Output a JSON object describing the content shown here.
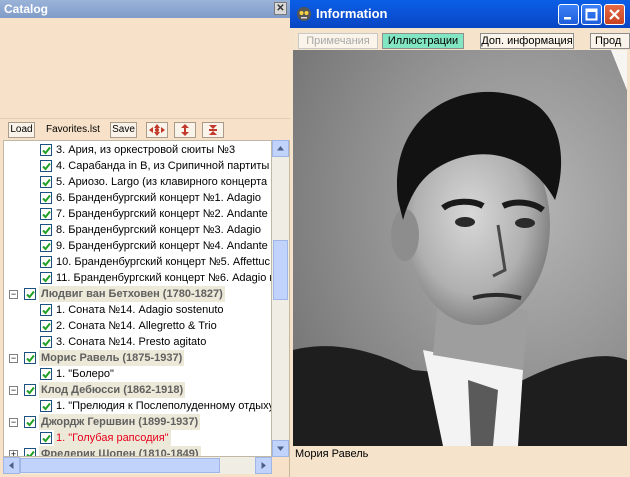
{
  "catalog": {
    "title": "Catalog",
    "toolbar": {
      "load_label": "Load",
      "favorites_label": "Favorites.lst",
      "save_label": "Save"
    },
    "tree": [
      {
        "kind": "item",
        "checked": true,
        "text": "3. Ария, из оркестровой сюиты №3"
      },
      {
        "kind": "item",
        "checked": true,
        "text": "4. Сарабанда in B, из Срипичной партиты №"
      },
      {
        "kind": "item",
        "checked": true,
        "text": "5. Ариозо. Largo (из клавирного концерта"
      },
      {
        "kind": "item",
        "checked": true,
        "text": "6. Бранденбургский концерт №1. Adagio"
      },
      {
        "kind": "item",
        "checked": true,
        "text": "7. Бранденбургский концерт №2. Andante"
      },
      {
        "kind": "item",
        "checked": true,
        "text": "8. Бранденбургский концерт №3. Adagio"
      },
      {
        "kind": "item",
        "checked": true,
        "text": "9. Бранденбургский концерт №4. Andante"
      },
      {
        "kind": "item",
        "checked": true,
        "text": "10. Бранденбургский концерт №5. Affettuc"
      },
      {
        "kind": "item",
        "checked": true,
        "text": "11. Бранденбургский концерт №6. Adagio r"
      },
      {
        "kind": "composer",
        "expanded": true,
        "checked": true,
        "text": "Людвиг ван Бетховен (1780-1827)"
      },
      {
        "kind": "item",
        "checked": true,
        "text": "1. Соната №14. Adagio sostenuto"
      },
      {
        "kind": "item",
        "checked": true,
        "text": "2. Соната №14. Allegretto & Trio"
      },
      {
        "kind": "item",
        "checked": true,
        "text": "3. Соната №14. Presto agitato"
      },
      {
        "kind": "composer",
        "expanded": true,
        "checked": true,
        "text": "Морис Равель (1875-1937)"
      },
      {
        "kind": "item",
        "checked": true,
        "text": "1. \"Болеро\""
      },
      {
        "kind": "composer",
        "expanded": true,
        "checked": true,
        "text": "Клод Дебюсси (1862-1918)"
      },
      {
        "kind": "item",
        "checked": true,
        "text": "1. \"Прелюдия к Послеполуденному отдыху"
      },
      {
        "kind": "composer",
        "expanded": true,
        "checked": true,
        "text": "Джордж Гершвин (1899-1937)"
      },
      {
        "kind": "selected",
        "checked": true,
        "text": "1. \"Голубая рапсодия\""
      },
      {
        "kind": "composer",
        "expanded": false,
        "checked": true,
        "text": "Фредерик Шопен (1810-1849)"
      }
    ]
  },
  "info": {
    "title": "Information",
    "tabs": [
      {
        "label": "Примечания",
        "state": "disabled"
      },
      {
        "label": "Иллюстрации",
        "state": "active"
      },
      {
        "label": "Доп. информация",
        "state": "normal"
      },
      {
        "label": "Прод",
        "state": "normal"
      }
    ],
    "caption": "Мория Равель"
  },
  "colors": {
    "panel_bg": "#f7e2c9",
    "titlebar_blue": "#0a5fe6",
    "active_tab": "#83e6c3",
    "selected_text": "#e8001c"
  }
}
